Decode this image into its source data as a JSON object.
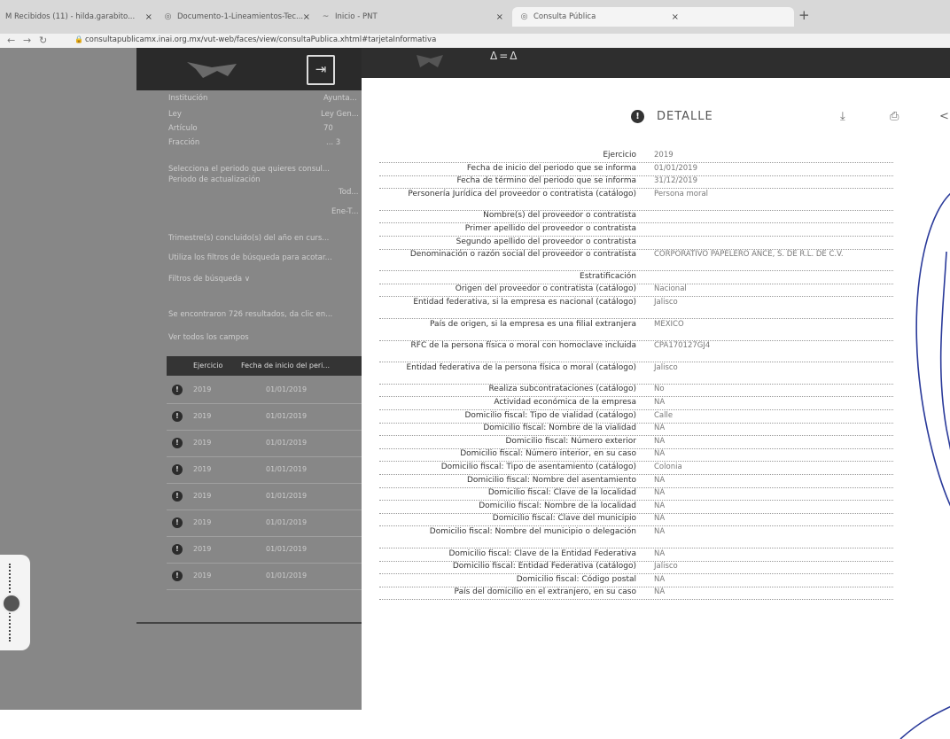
{
  "browser": {
    "tabs": [
      {
        "icon": "gmail-icon",
        "label": "M  Recibidos (11) - hilda.garabito...",
        "close": "×"
      },
      {
        "icon": "drive-icon",
        "label": "Documento-1-Lineamientos-Tec...",
        "close": "×"
      },
      {
        "icon": "pnt-icon",
        "label": "Inicio - PNT",
        "close": "×"
      },
      {
        "icon": "globe-icon",
        "label": "Consulta Pública",
        "close": "×"
      }
    ],
    "new_tab": "+",
    "url": "consultapublicamx.inai.org.mx/vut-web/faces/view/consultaPublica.xhtml#tarjetaInformativa"
  },
  "left_page": {
    "fields": [
      {
        "label": "Institución",
        "value": "Ayunta..."
      },
      {
        "label": "Ley",
        "value": "Ley Gen..."
      },
      {
        "label": "Artículo",
        "value": "70"
      },
      {
        "label": "Fracción",
        "value": "... 3"
      }
    ],
    "period_prompt": "Selecciona el periodo que quieres consul...",
    "period_label": "Periodo de actualización",
    "period_opt1": "Tod...",
    "period_opt2": "Ene-T...",
    "trimester_note": "Trimestre(s) concluido(s) del año en curs...",
    "filter_hint": "Utiliza los filtros de búsqueda para acotar...",
    "filters_label": "Filtros de búsqueda ∨",
    "results_text": "Se encontraron 726 resultados, da clic en...",
    "see_all": "Ver todos los campos",
    "table_headers": [
      "Ejercicio",
      "Fecha de inicio del peri..."
    ],
    "rows": [
      {
        "year": "2019",
        "date": "01/01/2019"
      },
      {
        "year": "2019",
        "date": "01/01/2019"
      },
      {
        "year": "2019",
        "date": "01/01/2019"
      },
      {
        "year": "2019",
        "date": "01/01/2019"
      },
      {
        "year": "2019",
        "date": "01/01/2019"
      },
      {
        "year": "2019",
        "date": "01/01/2019"
      },
      {
        "year": "2019",
        "date": "01/01/2019"
      },
      {
        "year": "2019",
        "date": "01/01/2019"
      }
    ]
  },
  "modal": {
    "top_mark": "Δ=Δ",
    "title": "DETALLE",
    "info_glyph": "!",
    "toolbar": [
      {
        "icon": "download-icon",
        "glyph": "⤓"
      },
      {
        "icon": "print-icon",
        "glyph": "⎙"
      },
      {
        "icon": "share-icon",
        "glyph": "<"
      }
    ],
    "details": [
      {
        "label": "Ejercicio",
        "value": "2019"
      },
      {
        "label": "Fecha de inicio del periodo que se informa",
        "value": "01/01/2019"
      },
      {
        "label": "Fecha de término del periodo que se informa",
        "value": "31/12/2019"
      },
      {
        "label": "Personería Jurídica del proveedor o contratista (catálogo)",
        "value": "Persona moral"
      },
      {
        "label": "Nombre(s) del proveedor o contratista",
        "value": ""
      },
      {
        "label": "Primer apellido del proveedor o contratista",
        "value": ""
      },
      {
        "label": "Segundo apellido del proveedor o contratista",
        "value": ""
      },
      {
        "label": "Denominación o razón social del proveedor o contratista",
        "value": "CORPORATIVO PAPELERO ANCE, S. DE R.L. DE C.V."
      },
      {
        "label": "Estratificación",
        "value": ""
      },
      {
        "label": "Origen del proveedor o contratista (catálogo)",
        "value": "Nacional"
      },
      {
        "label": "Entidad federativa, si la empresa es nacional (catálogo)",
        "value": "Jalisco"
      },
      {
        "label": "País de origen, si la empresa es una filial extranjera",
        "value": "MEXICO"
      },
      {
        "label": "RFC de la persona física o moral con homoclave incluida",
        "value": "CPA170127GJ4"
      },
      {
        "label": "Entidad federativa de la persona física o moral (catálogo)",
        "value": "Jalisco"
      },
      {
        "label": "Realiza subcontrataciones (catálogo)",
        "value": "No"
      },
      {
        "label": "Actividad económica de la empresa",
        "value": "NA"
      },
      {
        "label": "Domicilio fiscal: Tipo de vialidad (catálogo)",
        "value": "Calle"
      },
      {
        "label": "Domicilio fiscal: Nombre de la vialidad",
        "value": "NA"
      },
      {
        "label": "Domicilio fiscal: Número exterior",
        "value": "NA"
      },
      {
        "label": "Domicilio fiscal: Número interior, en su caso",
        "value": "NA"
      },
      {
        "label": "Domicilio fiscal: Tipo de asentamiento (catálogo)",
        "value": "Colonia"
      },
      {
        "label": "Domicilio fiscal: Nombre del asentamiento",
        "value": "NA"
      },
      {
        "label": "Domicilio fiscal: Clave de la localidad",
        "value": "NA"
      },
      {
        "label": "Domicilio fiscal: Nombre de la localidad",
        "value": "NA"
      },
      {
        "label": "Domicilio fiscal: Clave del municipio",
        "value": "NA"
      },
      {
        "label": "Domicilio fiscal: Nombre del municipio o delegación",
        "value": "NA"
      },
      {
        "label": "Domicilio fiscal: Clave de la Entidad Federativa",
        "value": "NA"
      },
      {
        "label": "Domicilio fiscal: Entidad Federativa (catálogo)",
        "value": "Jalisco"
      },
      {
        "label": "Domicilio fiscal: Código postal",
        "value": "NA"
      },
      {
        "label": "País del domicilio en el extranjero, en su caso",
        "value": "NA"
      }
    ]
  }
}
